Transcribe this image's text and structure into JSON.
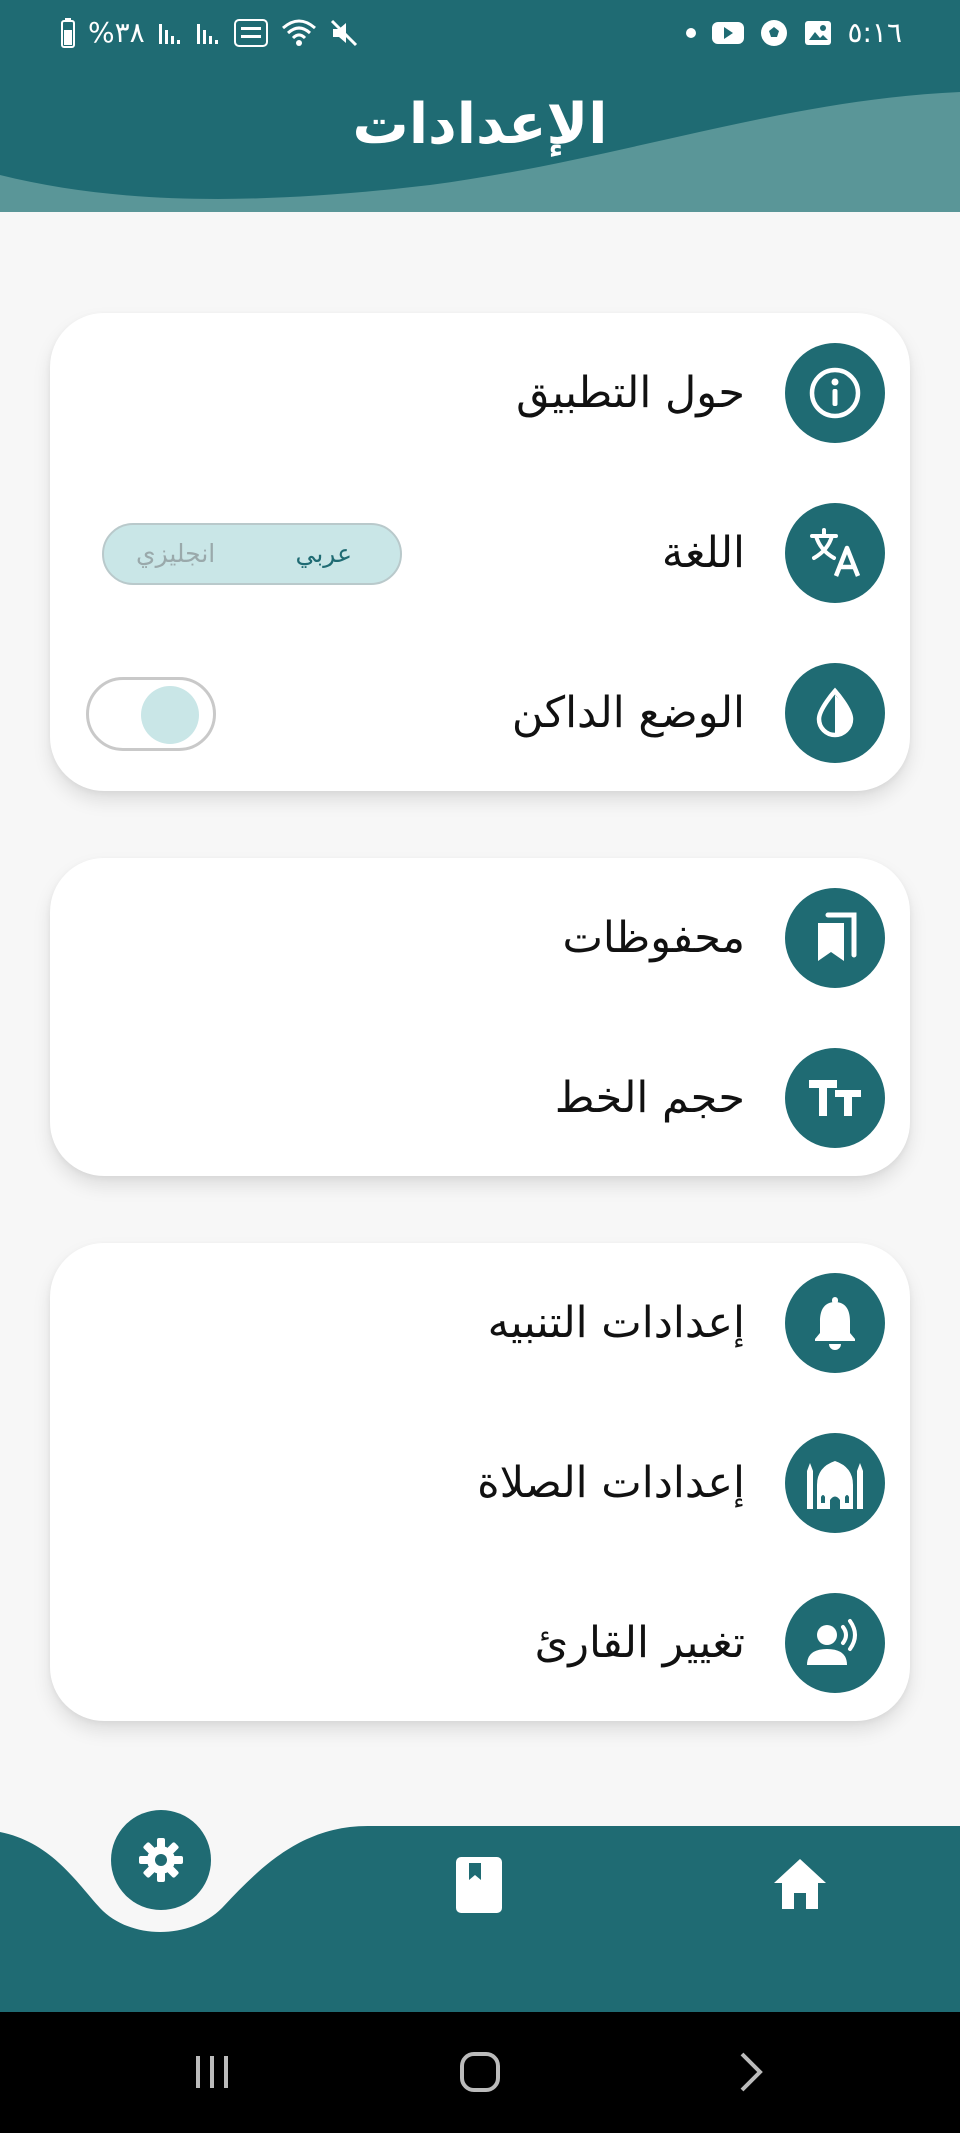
{
  "status_bar": {
    "time": "٥:١٦",
    "battery": "%٣٨"
  },
  "header": {
    "title": "الإعدادات"
  },
  "cards": [
    {
      "rows": [
        {
          "label": "حول التطبيق",
          "icon": "info-icon"
        },
        {
          "label": "اللغة",
          "icon": "translate-icon"
        },
        {
          "label": "الوضع الداكن",
          "icon": "drop-icon"
        }
      ]
    },
    {
      "rows": [
        {
          "label": "محفوظات",
          "icon": "bookmarks-icon"
        },
        {
          "label": "حجم الخط",
          "icon": "text-size-icon"
        }
      ]
    },
    {
      "rows": [
        {
          "label": "إعدادات التنبيه",
          "icon": "bell-icon"
        },
        {
          "label": "إعدادات الصلاة",
          "icon": "mosque-icon"
        },
        {
          "label": "تغيير القارئ",
          "icon": "speaker-person-icon"
        }
      ]
    }
  ],
  "language": {
    "selected": "عربي",
    "options": [
      "عربي",
      "انجليزي"
    ]
  },
  "dark_mode": {
    "enabled": false
  },
  "bottom_nav": {
    "active": "settings",
    "items": [
      "home-icon",
      "quran-book-icon",
      "settings-gear-icon"
    ]
  },
  "colors": {
    "primary": "#1f6b73",
    "header_wave_light": "#5a9698",
    "toggle_fill": "#c9e6e7",
    "background": "#f7f7f7"
  }
}
